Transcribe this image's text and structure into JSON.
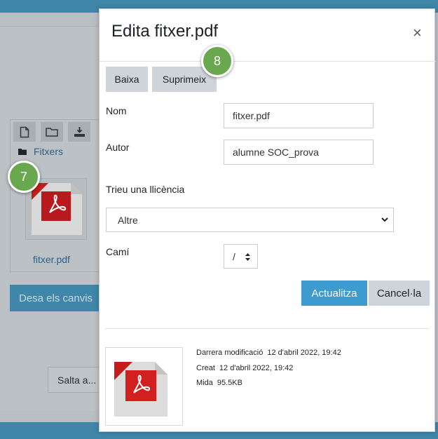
{
  "background": {
    "toolbar_icons": [
      "file-icon",
      "folder-icon",
      "download-icon"
    ],
    "folder_path": "Fitxers",
    "file_name": "fitxer.pdf",
    "save_label": "Desa els canvis",
    "skip_label": "Salta a..."
  },
  "badges": {
    "first": "7",
    "second": "8"
  },
  "modal": {
    "title": "Edita fitxer.pdf",
    "close_symbol": "×",
    "download_label": "Baixa",
    "delete_label": "Suprimeix",
    "name_label": "Nom",
    "name_value": "fitxer.pdf",
    "author_label": "Autor",
    "author_value": "alumne SOC_prova",
    "license_label": "Trieu una llicència",
    "license_value": "Altre",
    "path_label": "Camí",
    "path_value": "/",
    "update_label": "Actualitza",
    "cancel_label": "Cancel·la",
    "info": {
      "modified_label": "Darrera modificació",
      "modified_value": "12 d'abril 2022, 19:42",
      "created_label": "Creat",
      "created_value": "12 d'abril 2022, 19:42",
      "size_label": "Mida",
      "size_value": "95.5KB"
    }
  },
  "colors": {
    "primary": "#3d9bd0",
    "secondary": "#ced4da",
    "badge": "#6aa84f",
    "pdf_red": "#d21f1f"
  }
}
